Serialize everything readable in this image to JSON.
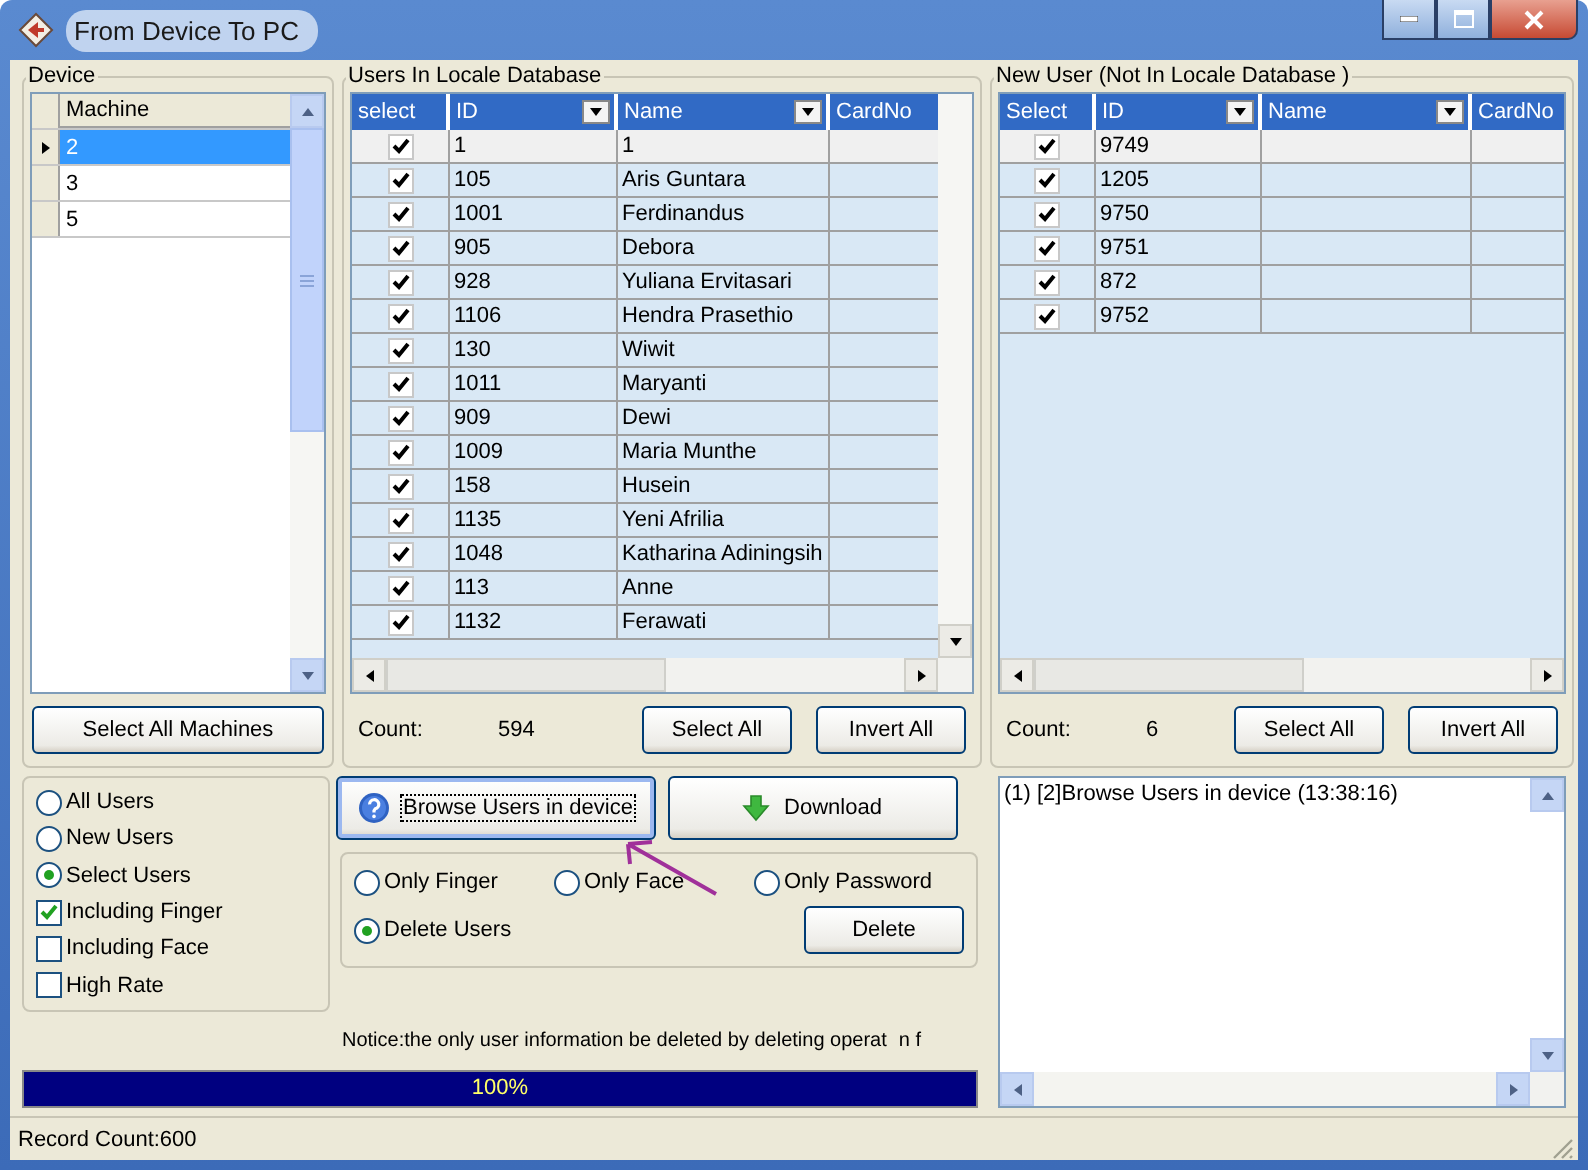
{
  "window": {
    "title": "From Device To PC"
  },
  "device_panel": {
    "title": "Device",
    "column": "Machine",
    "machines": [
      {
        "name": "2",
        "selected": true
      },
      {
        "name": "3",
        "selected": false
      },
      {
        "name": "5",
        "selected": false
      }
    ],
    "button": "Select All Machines"
  },
  "local_users": {
    "title": "Users In Locale Database",
    "columns": [
      {
        "label": "select",
        "filter": false
      },
      {
        "label": "ID",
        "filter": true
      },
      {
        "label": "Name",
        "filter": true
      },
      {
        "label": "CardNo",
        "filter": false
      }
    ],
    "rows": [
      {
        "checked": true,
        "current": true,
        "id": "1",
        "name": "1"
      },
      {
        "checked": true,
        "current": false,
        "id": "105",
        "name": "Aris Guntara"
      },
      {
        "checked": true,
        "current": false,
        "id": "1001",
        "name": "Ferdinandus"
      },
      {
        "checked": true,
        "current": false,
        "id": "905",
        "name": "Debora"
      },
      {
        "checked": true,
        "current": false,
        "id": "928",
        "name": "Yuliana Ervitasari"
      },
      {
        "checked": true,
        "current": false,
        "id": "1106",
        "name": "Hendra Prasethio"
      },
      {
        "checked": true,
        "current": false,
        "id": "130",
        "name": "Wiwit"
      },
      {
        "checked": true,
        "current": false,
        "id": "1011",
        "name": "Maryanti"
      },
      {
        "checked": true,
        "current": false,
        "id": "909",
        "name": "Dewi"
      },
      {
        "checked": true,
        "current": false,
        "id": "1009",
        "name": "Maria Munthe"
      },
      {
        "checked": true,
        "current": false,
        "id": "158",
        "name": "Husein"
      },
      {
        "checked": true,
        "current": false,
        "id": "1135",
        "name": "Yeni Afrilia"
      },
      {
        "checked": true,
        "current": false,
        "id": "1048",
        "name": "Katharina Adiningsih"
      },
      {
        "checked": true,
        "current": false,
        "id": "113",
        "name": "Anne"
      },
      {
        "checked": true,
        "current": false,
        "id": "1132",
        "name": "Ferawati"
      }
    ],
    "count_label": "Count:",
    "count": "594",
    "buttons": [
      "Select All",
      "Invert All"
    ]
  },
  "new_users": {
    "title": "New User (Not In Locale Database )",
    "columns": [
      {
        "label": "Select",
        "filter": false
      },
      {
        "label": "ID",
        "filter": true
      },
      {
        "label": "Name",
        "filter": true
      },
      {
        "label": "CardNo",
        "filter": false
      }
    ],
    "rows": [
      {
        "checked": true,
        "current": true,
        "id": "9749"
      },
      {
        "checked": true,
        "current": false,
        "id": "1205"
      },
      {
        "checked": true,
        "current": false,
        "id": "9750"
      },
      {
        "checked": true,
        "current": false,
        "id": "9751"
      },
      {
        "checked": true,
        "current": false,
        "id": "872"
      },
      {
        "checked": true,
        "current": false,
        "id": "9752"
      }
    ],
    "count_label": "Count:",
    "count": "6",
    "buttons": [
      "Select All",
      "Invert All"
    ]
  },
  "options": [
    {
      "kind": "radio",
      "label": "All Users",
      "selected": false
    },
    {
      "kind": "radio",
      "label": "New Users",
      "selected": false
    },
    {
      "kind": "radio",
      "label": "Select Users",
      "selected": true
    },
    {
      "kind": "checkbox",
      "label": "Including Finger",
      "checked": true
    },
    {
      "kind": "checkbox",
      "label": "Including Face",
      "checked": false
    },
    {
      "kind": "checkbox",
      "label": "High Rate",
      "checked": false
    }
  ],
  "actions": [
    {
      "kind": "browse",
      "label": "Browse Users in device",
      "focused": true
    },
    {
      "kind": "download",
      "label": "Download",
      "focused": false
    }
  ],
  "delete_options": [
    {
      "label": "Only Finger",
      "selected": false
    },
    {
      "label": "Only Face",
      "selected": false
    },
    {
      "label": "Only Password",
      "selected": false
    },
    {
      "label": "Delete Users",
      "selected": true
    }
  ],
  "delete_button": "Delete",
  "notice": "Notice:the only user information  be deleted by deleting operat",
  "notice_fragment": "n f",
  "progress": {
    "level": 1,
    "label": "100%"
  },
  "log": [
    "(1) [2]Browse Users in device (13:38:16)"
  ],
  "status_bar": "Record Count:600"
}
